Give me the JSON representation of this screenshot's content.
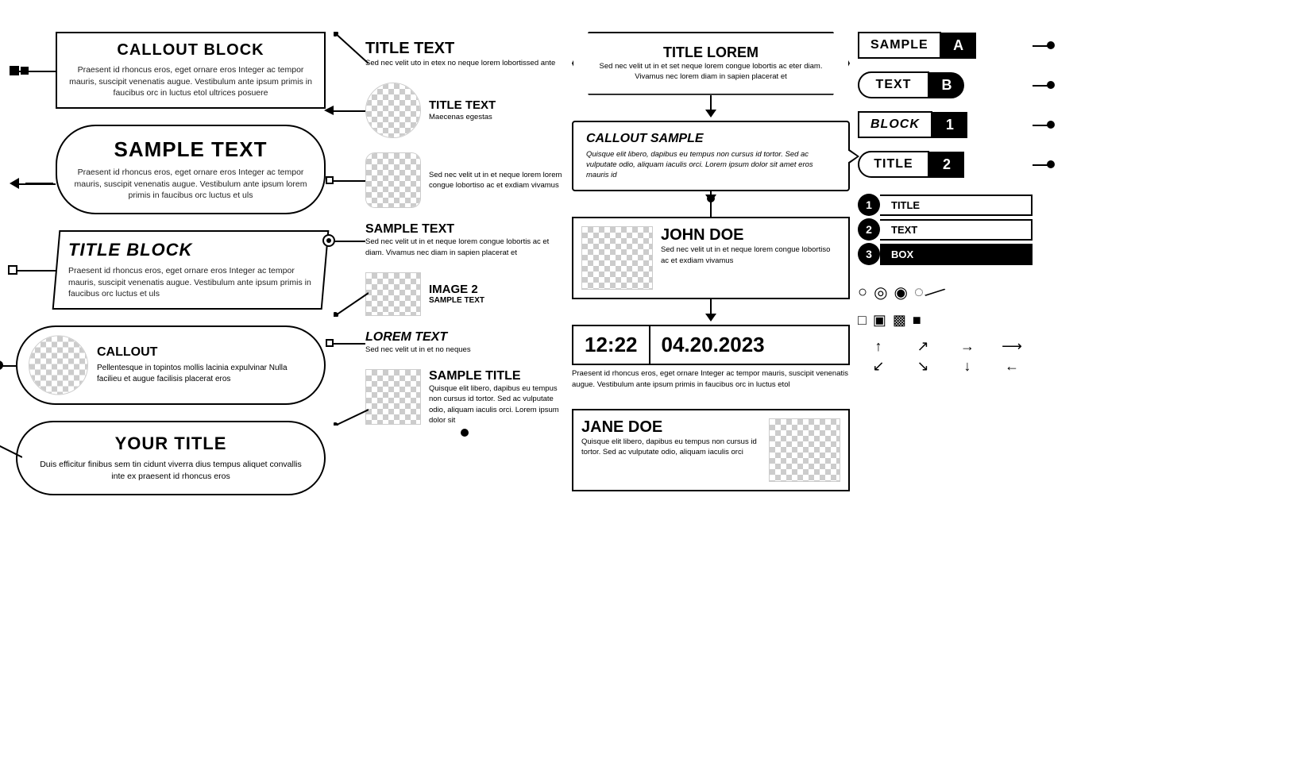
{
  "col1": {
    "callout_block": {
      "title": "CALLOUT BLOCK",
      "text": "Praesent id rhoncus eros, eget ornare eros Integer ac tempor mauris, suscipit venenatis augue. Vestibulum ante ipsum primis in faucibus orc in luctus etol ultrices posuere"
    },
    "sample_text": {
      "title": "SAMPLE TEXT",
      "text": "Praesent id rhoncus eros, eget ornare eros Integer ac tempor mauris, suscipit venenatis augue. Vestibulum ante ipsum lorem primis in faucibus orc luctus et uls"
    },
    "title_block": {
      "title": "TITLE BLOCK",
      "text": "Praesent id rhoncus eros, eget ornare eros Integer ac tempor mauris, suscipit venenatis augue. Vestibulum ante ipsum primis in faucibus orc luctus et uls"
    },
    "callout_circle": {
      "title": "CALLOUT",
      "text": "Pellentesque in topintos mollis lacinia expulvinar Nulla facilieu et augue facilisis placerat eros"
    },
    "your_title": {
      "title": "YOUR TITLE",
      "text": "Duis efficitur finibus sem tin cidunt viverra dius tempus aliquet convallis inte ex praesent id rhoncus eros"
    }
  },
  "col2": {
    "title_text_top": {
      "title": "TITLE TEXT",
      "text": "Sed nec velit uto in etex no neque lorem lobortissed ante"
    },
    "item2": {
      "title": "TITLE TEXT",
      "text": "Maecenas egestas"
    },
    "item3": {
      "text": "Sed nec velit ut in et neque lorem lorem congue lobortiso ac et exdiam vivamus"
    },
    "item4": {
      "title": "SAMPLE TEXT",
      "text": "Sed nec velit ut in et neque lorem congue lobortis ac et diam. Vivamus nec diam in sapien placerat et"
    },
    "item5": {
      "title": "IMAGE 2",
      "subtitle": "SAMPLE TEXT"
    },
    "item6": {
      "title": "LOREM TEXT",
      "text": "Sed nec velit ut in et no neques"
    },
    "item7": {
      "title": "SAMPLE TITLE",
      "text": "Quisque elit libero, dapibus eu tempus non cursus id tortor. Sed ac vulputate odio, aliquam iaculis orci. Lorem ipsum dolor sit"
    }
  },
  "col3": {
    "title_lorem": {
      "title": "TITLE LOREM",
      "text": "Sed nec velit ut in et set neque lorem congue lobortis ac eter diam. Vivamus nec lorem diam in sapien placerat et"
    },
    "callout_sample": {
      "title": "CALLOUT SAMPLE",
      "text": "Quisque elit libero, dapibus eu tempus non cursus id tortor. Sed ac vulputate odio, aliquam iaculis orci. Lorem ipsum dolor sit amet eros mauris id"
    },
    "john_doe": {
      "name": "JOHN DOE",
      "text": "Sed nec velit ut in et neque lorem congue lobortiso ac et exdiam vivamus"
    },
    "date_time": {
      "time": "12:22",
      "date": "04.20.2023",
      "text": "Praesent id rhoncus eros, eget ornare Integer ac tempor mauris, suscipit venenatis augue. Vestibulum ante ipsum primis in faucibus orc in luctus etol"
    },
    "jane_doe": {
      "name": "JANE DOE",
      "text": "Quisque elit libero, dapibus eu tempus non cursus id tortor. Sed ac vulputate odio, aliquam iaculis orci"
    }
  },
  "col4": {
    "item_a": {
      "label": "SAMPLE",
      "box": "A"
    },
    "item_b": {
      "label": "TEXT",
      "box": "B"
    },
    "item_1": {
      "label": "BLOCK",
      "box": "1"
    },
    "item_2": {
      "label": "TITLE",
      "box": "2"
    },
    "numbered": [
      {
        "num": "1",
        "label": "TITLE"
      },
      {
        "num": "2",
        "label": "TEXT"
      },
      {
        "num": "3",
        "label": "BOX",
        "black": true
      }
    ],
    "icons": {
      "circles": [
        "○",
        "◎",
        "◉",
        "◌"
      ],
      "squares": [
        "□",
        "▣",
        "▩",
        "■"
      ],
      "arrows": [
        "↑",
        "↗",
        "→",
        "↘",
        "←",
        "↙",
        "↓",
        "↙"
      ]
    }
  }
}
